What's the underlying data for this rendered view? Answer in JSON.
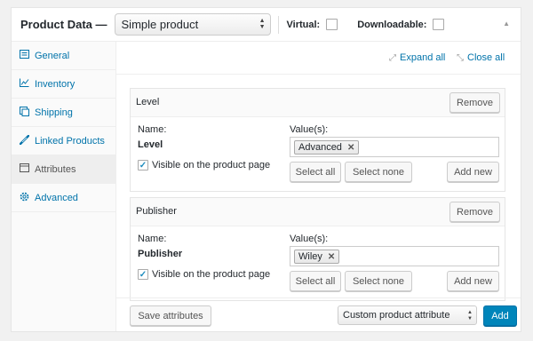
{
  "header": {
    "title": "Product Data —",
    "product_type": "Simple product",
    "virtual_label": "Virtual:",
    "downloadable_label": "Downloadable:"
  },
  "tabs": [
    {
      "label": "General",
      "icon": "general-icon"
    },
    {
      "label": "Inventory",
      "icon": "inventory-icon"
    },
    {
      "label": "Shipping",
      "icon": "shipping-icon"
    },
    {
      "label": "Linked Products",
      "icon": "link-icon"
    },
    {
      "label": "Attributes",
      "icon": "attributes-icon",
      "active": true
    },
    {
      "label": "Advanced",
      "icon": "gear-icon"
    }
  ],
  "toolbar": {
    "expand_all": "Expand all",
    "close_all": "Close all"
  },
  "attributes": [
    {
      "title": "Level",
      "remove_label": "Remove",
      "name_label": "Name:",
      "name_value": "Level",
      "values_label": "Value(s):",
      "tags": [
        "Advanced"
      ],
      "visible_label": "Visible on the product page",
      "visible_checked": true,
      "select_all_label": "Select all",
      "select_none_label": "Select none",
      "add_new_label": "Add new"
    },
    {
      "title": "Publisher",
      "remove_label": "Remove",
      "name_label": "Name:",
      "name_value": "Publisher",
      "values_label": "Value(s):",
      "tags": [
        "Wiley"
      ],
      "visible_label": "Visible on the product page",
      "visible_checked": true,
      "select_all_label": "Select all",
      "select_none_label": "Select none",
      "add_new_label": "Add new"
    }
  ],
  "footer": {
    "save_label": "Save attributes",
    "attribute_select": "Custom product attribute",
    "add_label": "Add"
  },
  "colors": {
    "link": "#0073aa",
    "primary": "#0085ba"
  }
}
